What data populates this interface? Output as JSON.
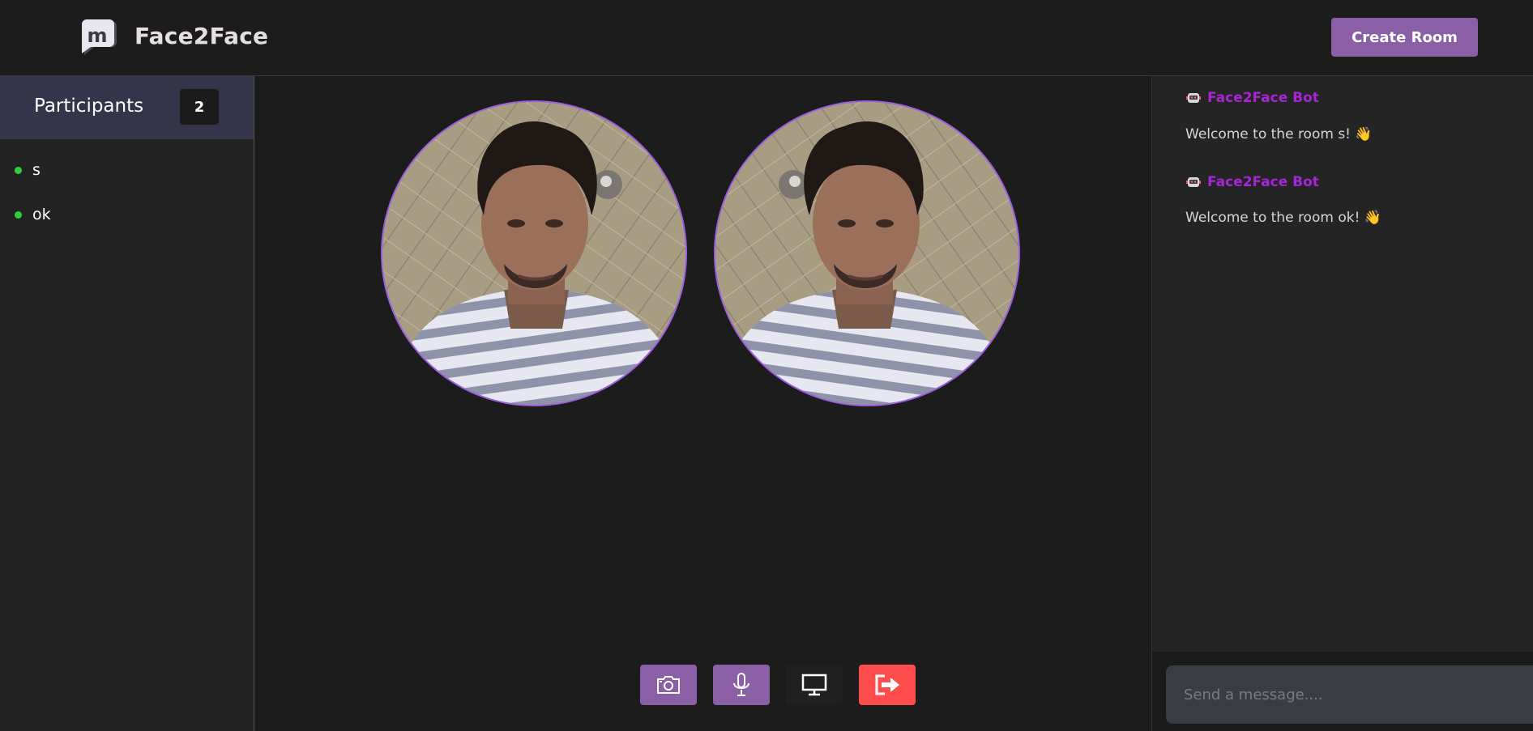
{
  "header": {
    "logo_icon": "m-chat-bubble-logo-icon",
    "brand": "Face2Face",
    "create_room_label": "Create Room"
  },
  "sidebar": {
    "title": "Participants",
    "count": "2",
    "participants": [
      {
        "name": "s",
        "status": "online"
      },
      {
        "name": "ok",
        "status": "online"
      }
    ]
  },
  "videos": [
    {
      "description_icon": "participant-video-feed"
    },
    {
      "description_icon": "participant-video-feed"
    }
  ],
  "controls": [
    {
      "icon": "camera-icon",
      "color": "#8a5fa6"
    },
    {
      "icon": "microphone-icon",
      "color": "#8a5fa6"
    },
    {
      "icon": "screen-share-icon",
      "color": "#202020"
    },
    {
      "icon": "leave-icon",
      "color": "#ff4d4d"
    }
  ],
  "chat": {
    "messages": [
      {
        "author": "Face2Face Bot",
        "text": "Welcome to the room s! 👋"
      },
      {
        "author": "Face2Face Bot",
        "text": "Welcome to the room ok! 👋"
      }
    ],
    "input_placeholder": "Send a message...."
  },
  "colors": {
    "accent": "#8a5fa6",
    "bot_name": "#a626d6",
    "online": "#2fce3c",
    "leave": "#ff4d4d",
    "video_ring": "#9e5ce0"
  }
}
